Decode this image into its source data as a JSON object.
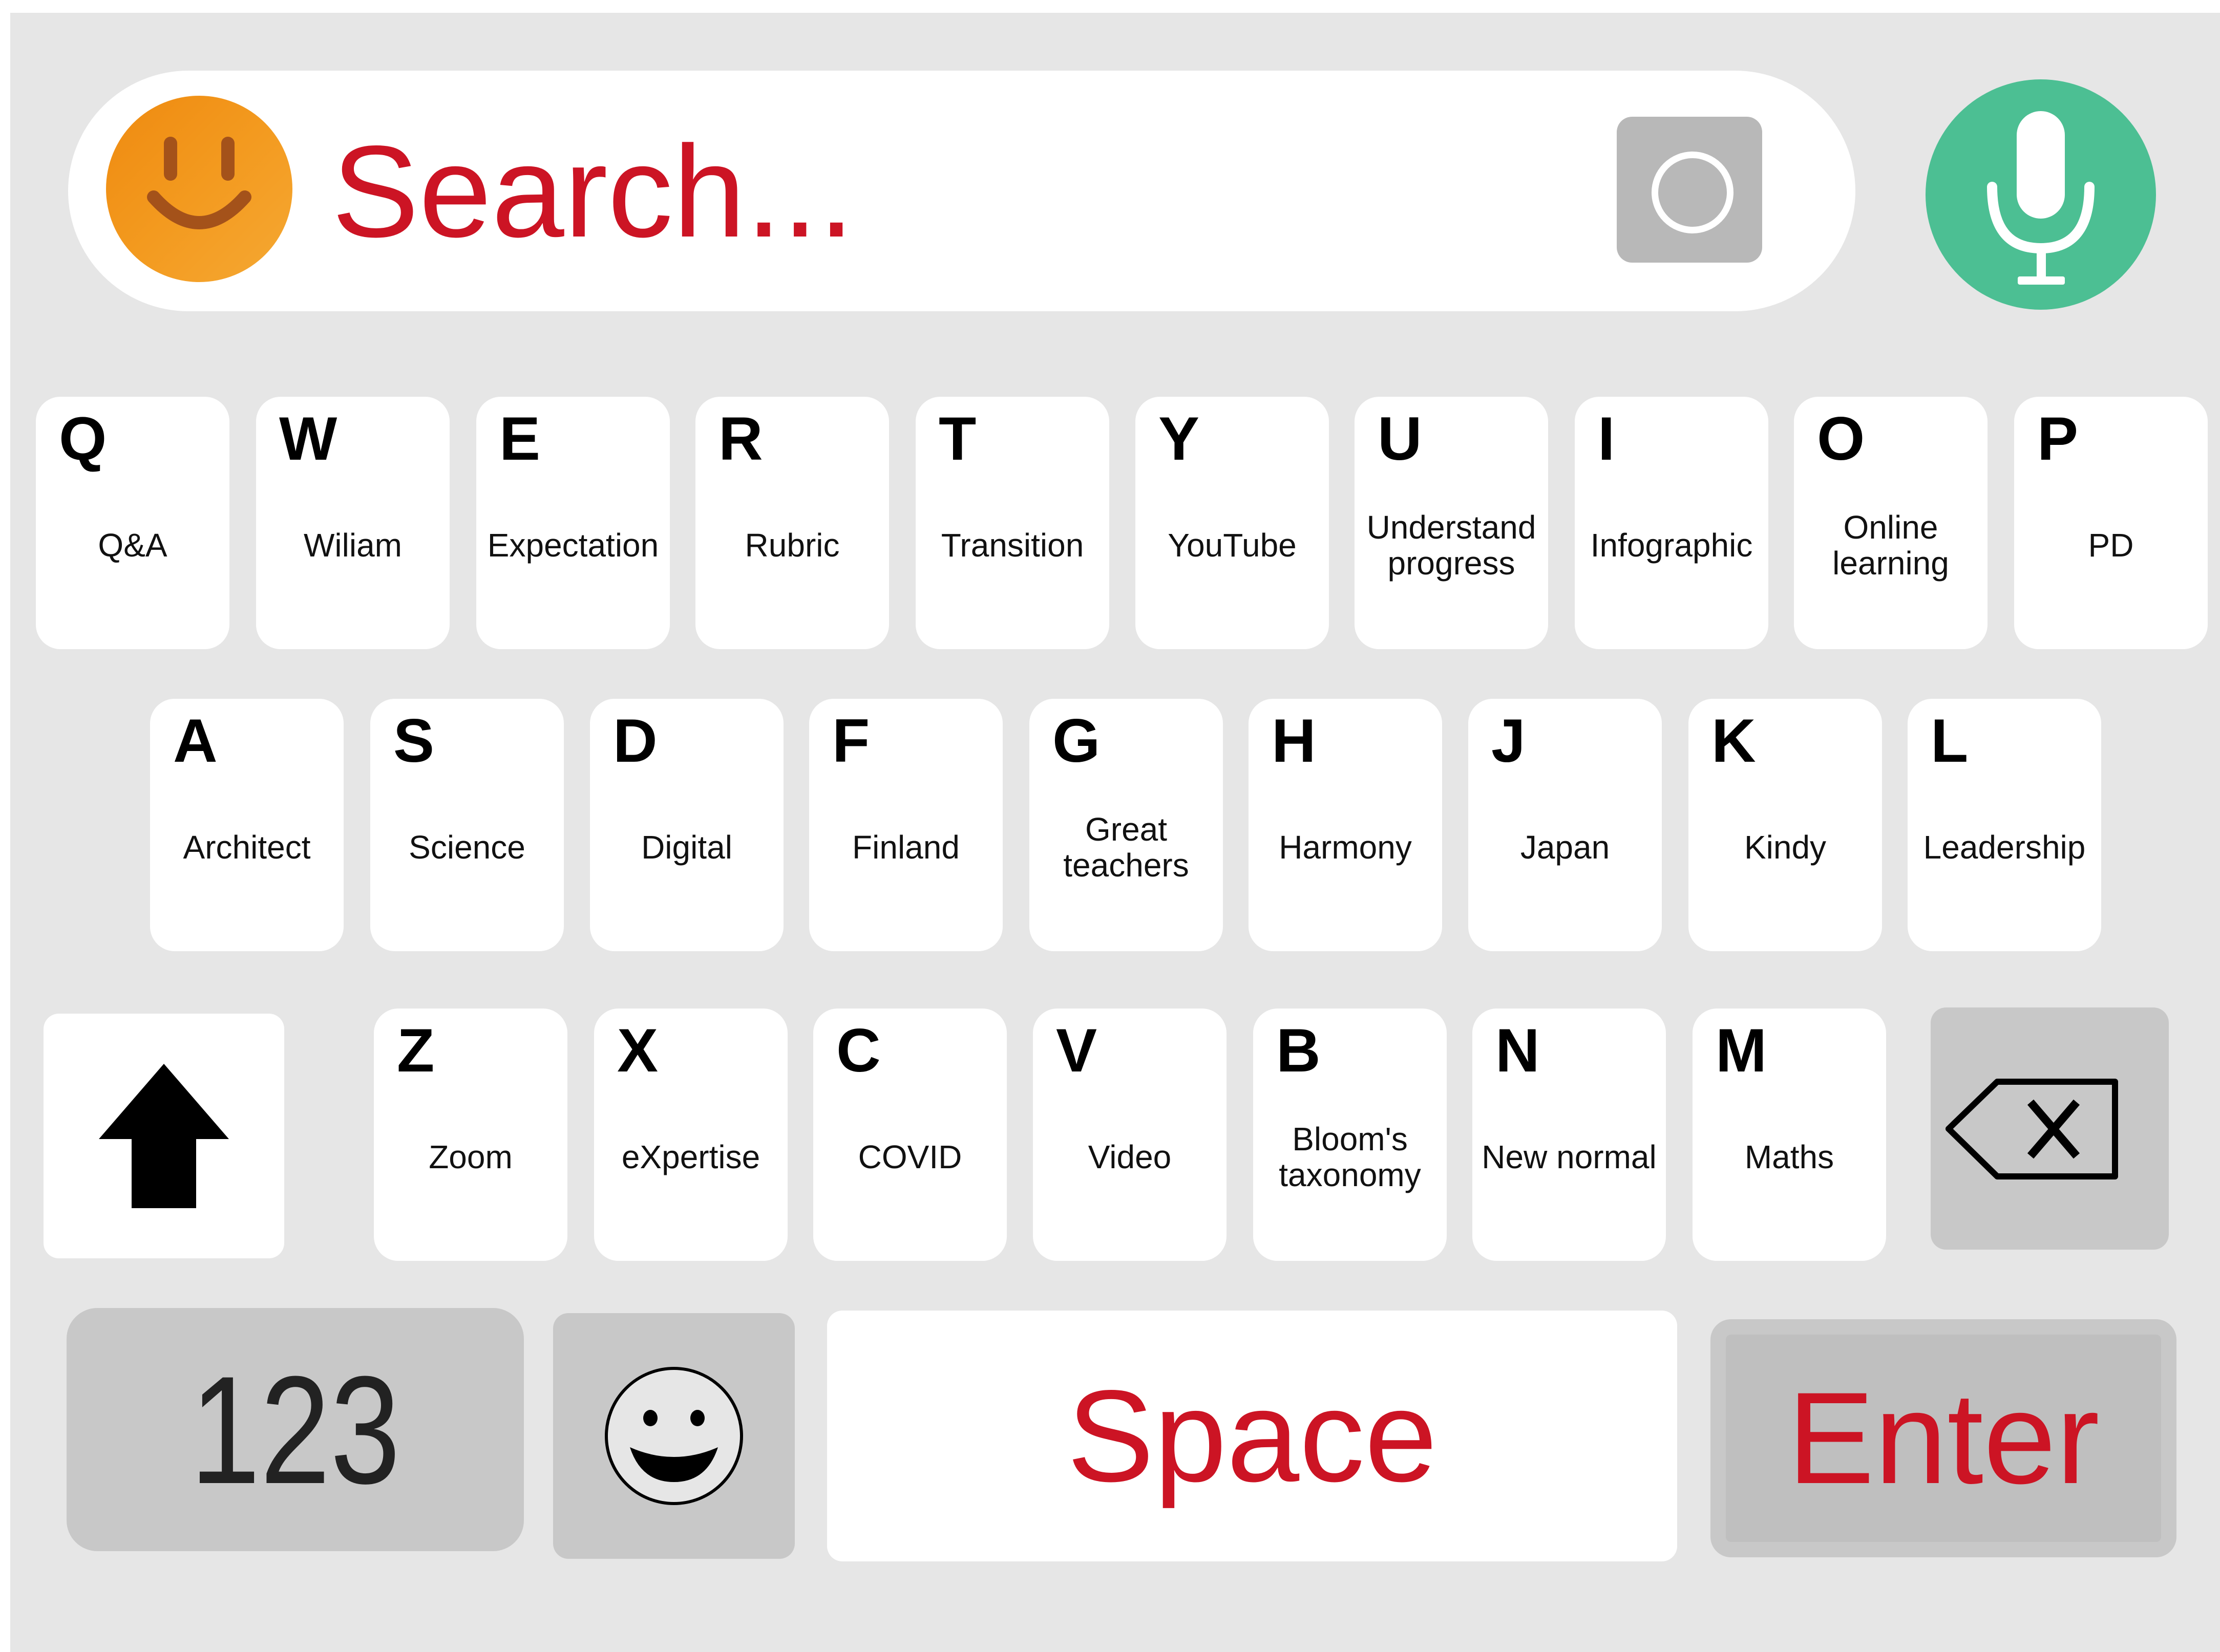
{
  "search": {
    "placeholder": "Search..."
  },
  "icons": {
    "logo": "smiley-face-icon",
    "camera": "camera-lens-icon",
    "mic": "microphone-icon",
    "shift": "arrow-up-icon",
    "backspace": "backspace-icon",
    "emoji": "smiley-icon"
  },
  "colors": {
    "accent_red": "#cc1424",
    "mic_green": "#4cbf93",
    "logo_orange": "#f39a1f",
    "board_gray": "#e6e6e6",
    "key_gray": "#c8c8c8"
  },
  "keyboard": {
    "row1": [
      {
        "letter": "Q",
        "word": "Q&A"
      },
      {
        "letter": "W",
        "word": "Wiliam"
      },
      {
        "letter": "E",
        "word": "Expectation"
      },
      {
        "letter": "R",
        "word": "Rubric"
      },
      {
        "letter": "T",
        "word": "Transition"
      },
      {
        "letter": "Y",
        "word": "YouTube"
      },
      {
        "letter": "U",
        "word": "Understand progress"
      },
      {
        "letter": "I",
        "word": "Infographic"
      },
      {
        "letter": "O",
        "word": "Online learning"
      },
      {
        "letter": "P",
        "word": "PD"
      }
    ],
    "row2": [
      {
        "letter": "A",
        "word": "Architect"
      },
      {
        "letter": "S",
        "word": "Science"
      },
      {
        "letter": "D",
        "word": "Digital"
      },
      {
        "letter": "F",
        "word": "Finland"
      },
      {
        "letter": "G",
        "word": "Great teachers"
      },
      {
        "letter": "H",
        "word": "Harmony"
      },
      {
        "letter": "J",
        "word": "Japan"
      },
      {
        "letter": "K",
        "word": "Kindy"
      },
      {
        "letter": "L",
        "word": "Leadership"
      }
    ],
    "row3": [
      {
        "letter": "Z",
        "word": "Zoom"
      },
      {
        "letter": "X",
        "word": "eXpertise"
      },
      {
        "letter": "C",
        "word": "COVID"
      },
      {
        "letter": "V",
        "word": "Video"
      },
      {
        "letter": "B",
        "word": "Bloom's taxonomy"
      },
      {
        "letter": "N",
        "word": "New normal"
      },
      {
        "letter": "M",
        "word": "Maths"
      }
    ],
    "bottom": {
      "numbers_label": "123",
      "space_label": "Space",
      "enter_label": "Enter"
    }
  }
}
